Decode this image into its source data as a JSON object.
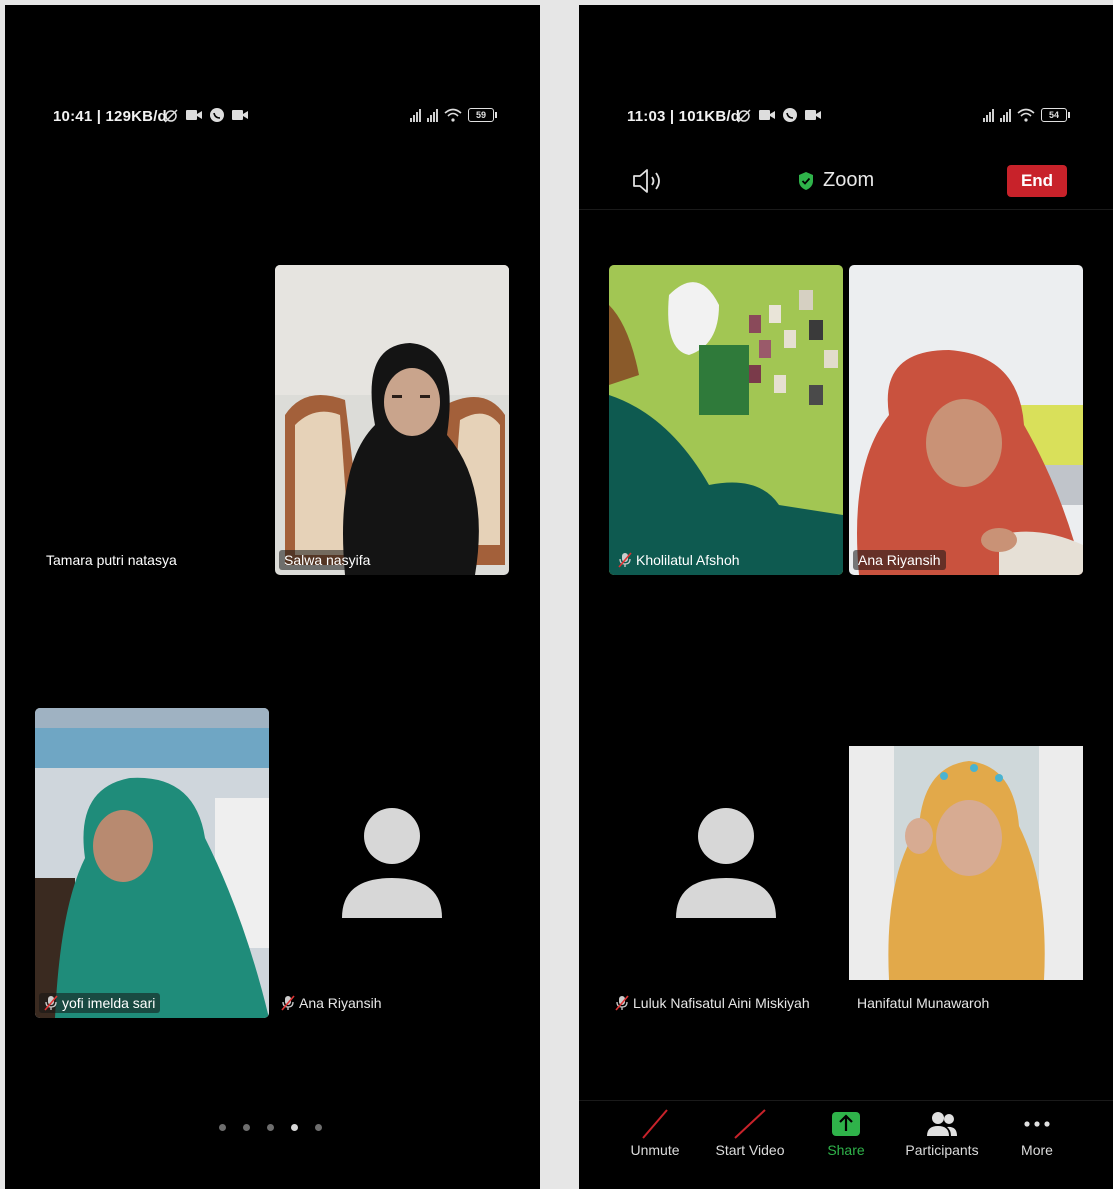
{
  "left": {
    "status": {
      "time": "10:41 | 129KB/d",
      "battery": "59"
    },
    "tiles": [
      {
        "name": "Tamara putri natasya",
        "muted": false
      },
      {
        "name": "Salwa nasyifa",
        "muted": false
      },
      {
        "name": "yofi imelda sari",
        "muted": true
      },
      {
        "name": "Ana Riyansih",
        "muted": true
      }
    ],
    "pager": {
      "count": 5,
      "active": 4
    }
  },
  "right": {
    "status": {
      "time": "11:03 | 101KB/d",
      "battery": "54"
    },
    "header": {
      "title": "Zoom",
      "end_label": "End"
    },
    "tiles": [
      {
        "name": "Kholilatul Afshoh",
        "muted": true
      },
      {
        "name": "Ana Riyansih",
        "muted": false
      },
      {
        "name": "Luluk Nafisatul Aini Miskiyah",
        "muted": true
      },
      {
        "name": "Hanifatul Munawaroh",
        "muted": false
      }
    ],
    "toolbar": {
      "unmute_label": "Unmute",
      "start_video_label": "Start Video",
      "share_label": "Share",
      "participants_label": "Participants",
      "more_label": "More"
    }
  },
  "colors": {
    "end": "#c8222a",
    "share": "#2fb34a",
    "shield": "#2fb34a",
    "background": "#000000"
  },
  "icons": [
    "speaker-icon",
    "shield-check-icon",
    "mic-off-icon",
    "avatar-icon",
    "share-icon",
    "participants-icon",
    "more-icon",
    "video-off-icon",
    "wifi-icon",
    "signal-icon",
    "battery-icon"
  ]
}
